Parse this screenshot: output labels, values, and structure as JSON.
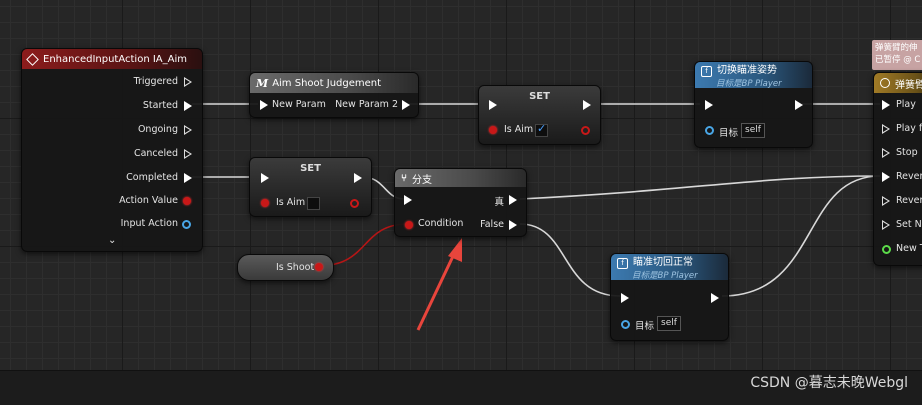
{
  "nodes": {
    "input_action": {
      "title": "EnhancedInputAction IA_Aim",
      "pins": [
        "Triggered",
        "Started",
        "Ongoing",
        "Canceled",
        "Completed",
        "Action Value",
        "Input Action"
      ]
    },
    "aim_shoot": {
      "title": "Aim Shoot Judgement",
      "in_label": "New Param",
      "out_label": "New Param 2"
    },
    "set_aim_true": {
      "title": "SET",
      "var_label": "Is Aim",
      "checked": true
    },
    "set_aim_false": {
      "title": "SET",
      "var_label": "Is Aim",
      "checked": false
    },
    "is_shoot": {
      "label": "Is Shoot"
    },
    "branch": {
      "title": "分支",
      "condition": "Condition",
      "true_label": "真",
      "false_label": "False"
    },
    "switch_aim": {
      "title": "切换瞄准姿势",
      "subtitle": "目标是BP Player",
      "target_label": "目标",
      "target_value": "self"
    },
    "aim_return": {
      "title": "瞄准切回正常",
      "subtitle": "目标是BP Player",
      "target_label": "目标",
      "target_value": "self"
    },
    "timeline": {
      "title": "弹簧臂",
      "pins": [
        "Play",
        "Play fr",
        "Stop",
        "Revers",
        "Revers",
        "Set Ne",
        "New T"
      ]
    }
  },
  "comment": {
    "line1": "弹簧臂的伸",
    "line2": "已暂停 @ C"
  },
  "watermark": "CSDN @暮志未晚Webgl",
  "colors": {
    "exec": "#ffffff",
    "bool": "#c81818",
    "object": "#49a6e6",
    "annotation_arrow": "#e8453c"
  }
}
